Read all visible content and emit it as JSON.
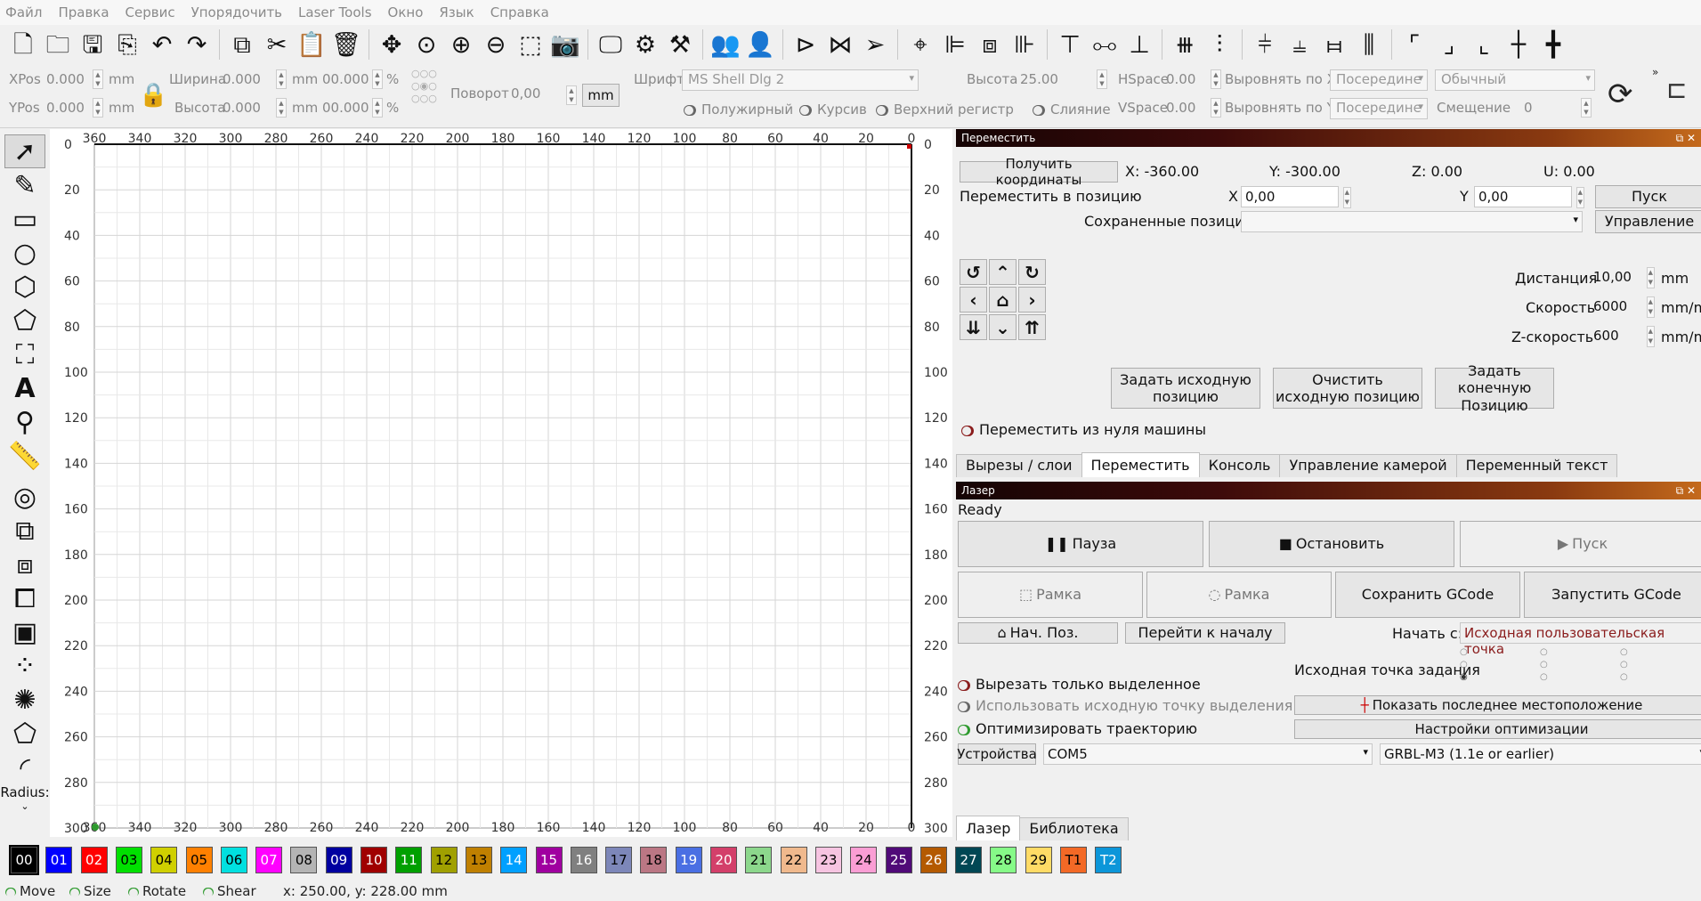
{
  "menu": [
    "Файл",
    "Правка",
    "Сервис",
    "Упорядочить",
    "Laser Tools",
    "Окно",
    "Язык",
    "Справка"
  ],
  "toolbar_icons": [
    "new-file-icon",
    "open-folder-icon",
    "save-icon",
    "export-icon",
    "undo-icon",
    "redo-icon",
    "copy-icon",
    "cut-icon",
    "paste-icon",
    "delete-icon",
    "move-icon",
    "zoom-fit-icon",
    "zoom-in-icon",
    "zoom-out-icon",
    "frame-select-icon",
    "camera-icon",
    "monitor-icon",
    "gear-icon",
    "tools-icon",
    "group-icon",
    "user-icon",
    "mirror-h-icon",
    "mirror-v-icon",
    "send-icon",
    "target-icon",
    "align-left-icon",
    "align-center-icon",
    "align-right-icon",
    "align-top-icon",
    "align-middle-icon",
    "align-bottom-icon",
    "distribute-h-icon",
    "distribute-v-icon",
    "space-h-icon",
    "space-v-icon",
    "equal-w-icon",
    "equal-h-icon",
    "corner-tl-icon",
    "corner-br-icon",
    "corner-bl-icon",
    "crosshair-h-icon",
    "crosshair-icon"
  ],
  "props": {
    "xpos_label": "XPos",
    "xpos": "0.000",
    "ypos_label": "YPos",
    "ypos": "0.000",
    "unit": "mm",
    "width_label": "Ширина",
    "width": "0.000",
    "height_label": "Высота",
    "height": "0.000",
    "pct1": "00.000",
    "pct2": "00.000",
    "pct": "%",
    "rotate_label": "Поворот",
    "rotate": "0,00",
    "mm_button": "mm",
    "font_label": "Шрифт",
    "font_value": "MS Shell Dlg 2",
    "font_height_label": "Высота",
    "font_height": "25.00",
    "hspace_label": "HSpace",
    "hspace": "0.00",
    "vspace_label": "VSpace",
    "vspace": "0.00",
    "align_x_label": "Выровнять по X",
    "align_x": "Посередине",
    "align_y_label": "Выровнять по Y",
    "align_y": "Посередине",
    "style_value": "Обычный",
    "offset_label": "Смещение",
    "offset": "0",
    "bold": "Полужирный",
    "italic": "Курсив",
    "upper": "Верхний регистр",
    "weld": "Слияние"
  },
  "canvas": {
    "x_ticks": [
      "360",
      "340",
      "320",
      "300",
      "280",
      "260",
      "240",
      "220",
      "200",
      "180",
      "160",
      "140",
      "120",
      "100",
      "80",
      "60",
      "40",
      "20",
      "0"
    ],
    "y_ticks": [
      "0",
      "20",
      "40",
      "60",
      "80",
      "100",
      "120",
      "140",
      "160",
      "180",
      "200",
      "220",
      "240",
      "260",
      "280",
      "300"
    ]
  },
  "move_panel": {
    "title": "Переместить",
    "get_coords": "Получить координаты",
    "x_readout": "X: -360.00",
    "y_readout": "Y: -300.00",
    "z_readout": "Z: 0.00",
    "u_readout": "U: 0.00",
    "move_to": "Переместить в позицию",
    "x_label": "X",
    "x_value": "0,00",
    "y_label": "Y",
    "y_value": "0,00",
    "go_button": "Пуск",
    "saved_label": "Сохраненные позиции:",
    "saved_value": "",
    "manage_button": "Управление",
    "distance_label": "Дистанция",
    "distance": "10,00",
    "distance_unit": "mm",
    "speed_label": "Скорость",
    "speed": "6000",
    "speed_unit": "mm/m",
    "zspeed_label": "Z-скорость",
    "zspeed": "600",
    "zspeed_unit": "mm/m",
    "set_origin": "Задать исходную позицию",
    "clear_origin": "Очистить исходную позицию",
    "set_end": "Задать конечную Позицию",
    "from_zero": "Переместить из нуля машины"
  },
  "tabs1": [
    "Вырезы / слои",
    "Переместить",
    "Консоль",
    "Управление камерой",
    "Переменный текст"
  ],
  "laser_panel": {
    "title": "Лазер",
    "status": "Ready",
    "pause": "Пауза",
    "stop": "Остановить",
    "start": "Пуск",
    "frame1": "Рамка",
    "frame2": "Рамка",
    "save_gcode": "Сохранить GCode",
    "run_gcode": "Запустить GCode",
    "home": "Нач. Поз.",
    "go_origin": "Перейти к началу",
    "start_from_label": "Начать с:",
    "start_from": "Исходная пользовательская точка",
    "job_origin_label": "Исходная точка задания",
    "cut_selected": "Вырезать только выделенное",
    "use_selection_origin": "Использовать исходную точку выделения",
    "optimize": "Оптимизировать траекторию",
    "show_last": "Показать последнее местоположение",
    "opt_settings": "Настройки оптимизации",
    "devices": "Устройства",
    "port": "COM5",
    "controller": "GRBL-M3 (1.1e or earlier)"
  },
  "tabs2": [
    "Лазер",
    "Библиотека"
  ],
  "palette": [
    {
      "l": "00",
      "c": "#000000",
      "t": "#ffffff"
    },
    {
      "l": "01",
      "c": "#0000ff",
      "t": "#ffffff"
    },
    {
      "l": "02",
      "c": "#ff0000",
      "t": "#ffffff"
    },
    {
      "l": "03",
      "c": "#00e000",
      "t": "#000000"
    },
    {
      "l": "04",
      "c": "#d0d000",
      "t": "#000000"
    },
    {
      "l": "05",
      "c": "#ff8000",
      "t": "#000000"
    },
    {
      "l": "06",
      "c": "#00e0e0",
      "t": "#000000"
    },
    {
      "l": "07",
      "c": "#ff00ff",
      "t": "#ffffff"
    },
    {
      "l": "08",
      "c": "#b4b4b4",
      "t": "#000000"
    },
    {
      "l": "09",
      "c": "#0000a0",
      "t": "#ffffff"
    },
    {
      "l": "10",
      "c": "#a00000",
      "t": "#ffffff"
    },
    {
      "l": "11",
      "c": "#00a000",
      "t": "#ffffff"
    },
    {
      "l": "12",
      "c": "#a0a000",
      "t": "#000000"
    },
    {
      "l": "13",
      "c": "#c08000",
      "t": "#000000"
    },
    {
      "l": "14",
      "c": "#00a0ff",
      "t": "#ffffff"
    },
    {
      "l": "15",
      "c": "#a000a0",
      "t": "#ffffff"
    },
    {
      "l": "16",
      "c": "#808080",
      "t": "#ffffff"
    },
    {
      "l": "17",
      "c": "#7d87b9",
      "t": "#000000"
    },
    {
      "l": "18",
      "c": "#bb7784",
      "t": "#000000"
    },
    {
      "l": "19",
      "c": "#4a6fe3",
      "t": "#ffffff"
    },
    {
      "l": "20",
      "c": "#d33f6a",
      "t": "#ffffff"
    },
    {
      "l": "21",
      "c": "#8cd78c",
      "t": "#000000"
    },
    {
      "l": "22",
      "c": "#f0b98d",
      "t": "#000000"
    },
    {
      "l": "23",
      "c": "#f6c4e1",
      "t": "#000000"
    },
    {
      "l": "24",
      "c": "#fa9ed4",
      "t": "#000000"
    },
    {
      "l": "25",
      "c": "#500a78",
      "t": "#ffffff"
    },
    {
      "l": "26",
      "c": "#b45a00",
      "t": "#ffffff"
    },
    {
      "l": "27",
      "c": "#004754",
      "t": "#ffffff"
    },
    {
      "l": "28",
      "c": "#86fa88",
      "t": "#000000"
    },
    {
      "l": "29",
      "c": "#ffdb66",
      "t": "#000000"
    },
    {
      "l": "T1",
      "c": "#f36926",
      "t": "#000000"
    },
    {
      "l": "T2",
      "c": "#0c96d9",
      "t": "#ffffff"
    }
  ],
  "status": {
    "move": "Move",
    "size": "Size",
    "rotate": "Rotate",
    "shear": "Shear",
    "coords": "x: 250.00, y: 228.00 mm"
  },
  "left_tools": {
    "radius_label": "Radius:"
  }
}
